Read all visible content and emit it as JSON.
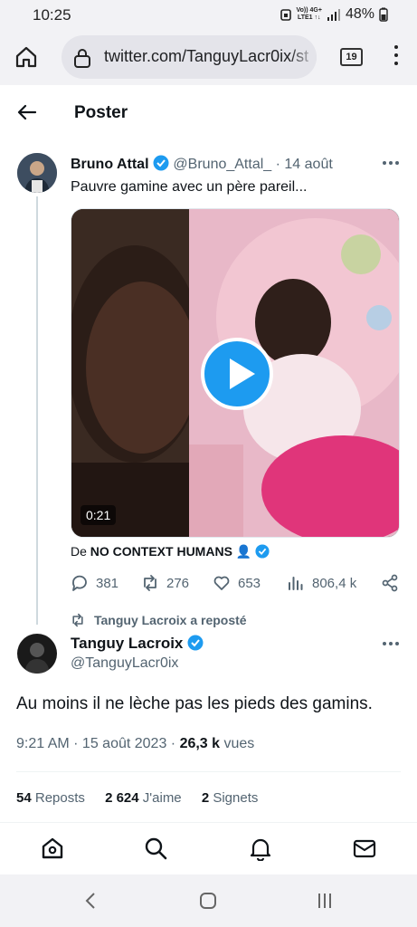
{
  "status_bar": {
    "time": "10:25",
    "net_top": "Vo)) 4G+",
    "net_bottom": "LTE1 ↑↓",
    "battery": "48%"
  },
  "browser": {
    "url": "twitter.com/TanguyLacr0ix/st",
    "tab_count": "19"
  },
  "header": {
    "title": "Poster"
  },
  "tweet1": {
    "name": "Bruno Attal",
    "handle": "@Bruno_Attal_",
    "date": "· 14 août",
    "text": "Pauvre gamine avec un père pareil...",
    "video_duration": "0:21",
    "source_prefix": "De ",
    "source_name": "NO CONTEXT HUMANS 👤",
    "replies": "381",
    "reposts": "276",
    "likes": "653",
    "views": "806,4 k"
  },
  "repost_note": "Tanguy Lacroix a reposté",
  "tweet2": {
    "name": "Tanguy Lacroix",
    "handle": "@TanguyLacr0ix",
    "text": "Au moins il ne lèche pas les pieds des gamins.",
    "time": "9:21 AM · 15 août 2023 · ",
    "views_count": "26,3 k",
    "views_label": " vues",
    "reposts_count": "54",
    "reposts_label": " Reposts",
    "likes_count": "2 624",
    "likes_label": " J'aime",
    "bookmarks_count": "2",
    "bookmarks_label": " Signets"
  },
  "colors": {
    "accent": "#1d9bf0",
    "muted": "#536471",
    "text": "#0f1419"
  }
}
